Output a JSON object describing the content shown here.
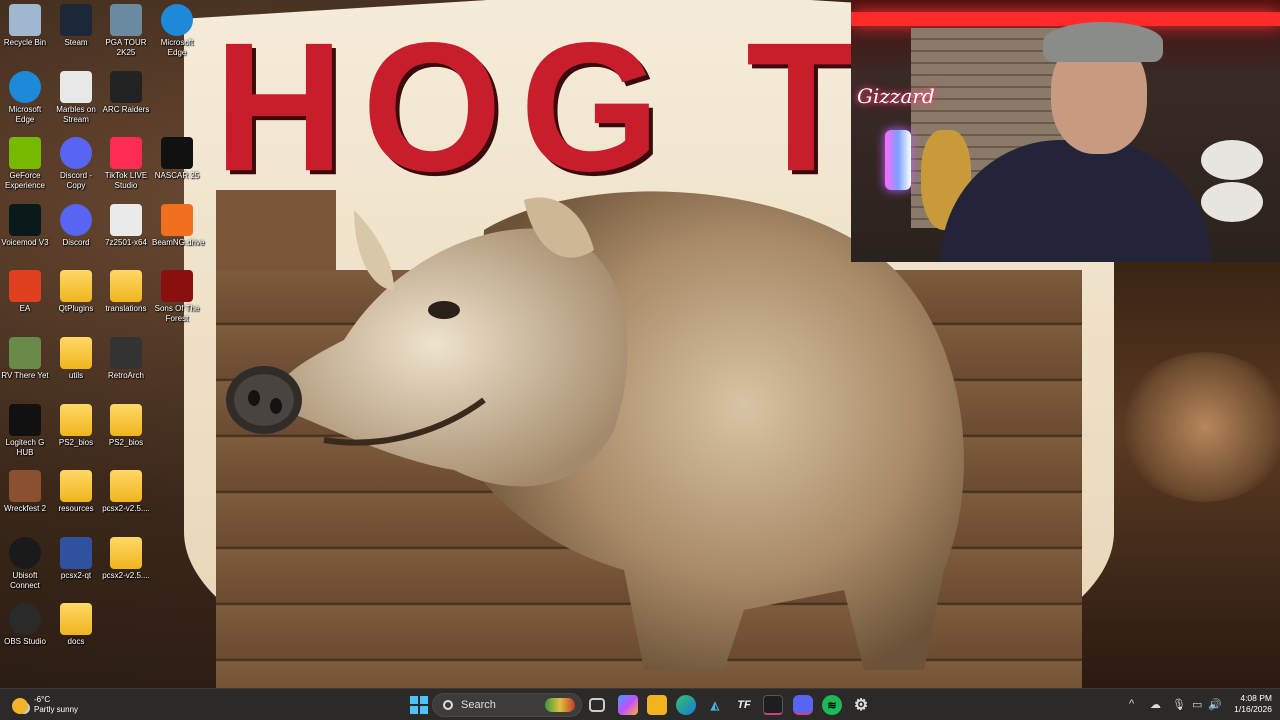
{
  "wallpaper": {
    "title_text": "HOG TAI"
  },
  "desktop_icons": [
    {
      "label": "Recycle Bin",
      "icon": "recycle-bin-icon"
    },
    {
      "label": "Steam",
      "icon": "steam-icon"
    },
    {
      "label": "PGA TOUR 2K25",
      "icon": "pga-tour-icon"
    },
    {
      "label": "Microsoft Edge",
      "icon": "edge-icon"
    },
    {
      "label": "Microsoft Edge",
      "icon": "edge-icon"
    },
    {
      "label": "Marbles on Stream",
      "icon": "marbles-icon"
    },
    {
      "label": "ARC Raiders",
      "icon": "arc-raiders-icon"
    },
    {
      "label": "GeForce Experience",
      "icon": "geforce-icon"
    },
    {
      "label": "Discord - Copy",
      "icon": "discord-icon"
    },
    {
      "label": "TikTok LIVE Studio",
      "icon": "tiktok-icon"
    },
    {
      "label": "NASCAR 25",
      "icon": "nascar-icon"
    },
    {
      "label": "Voicemod V3",
      "icon": "voicemod-icon"
    },
    {
      "label": "Discord",
      "icon": "discord-icon"
    },
    {
      "label": "7z2501-x64",
      "icon": "7zip-icon"
    },
    {
      "label": "BeamNG.drive",
      "icon": "beamng-icon"
    },
    {
      "label": "EA",
      "icon": "ea-icon"
    },
    {
      "label": "QtPlugins",
      "icon": "folder-icon"
    },
    {
      "label": "translations",
      "icon": "folder-icon"
    },
    {
      "label": "Sons Of The Forest",
      "icon": "sons-forest-icon"
    },
    {
      "label": "RV There Yet",
      "icon": "rv-there-yet-icon"
    },
    {
      "label": "utils",
      "icon": "folder-icon"
    },
    {
      "label": "RetroArch",
      "icon": "retroarch-icon"
    },
    {
      "label": "Logitech G HUB",
      "icon": "logitech-icon"
    },
    {
      "label": "PS2_bios",
      "icon": "folder-icon"
    },
    {
      "label": "PS2_bios",
      "icon": "folder-icon"
    },
    {
      "label": "Wreckfest 2",
      "icon": "wreckfest-icon"
    },
    {
      "label": "resources",
      "icon": "folder-icon"
    },
    {
      "label": "pcsx2-v2.5....",
      "icon": "folder-icon"
    },
    {
      "label": "Ubisoft Connect",
      "icon": "ubisoft-icon"
    },
    {
      "label": "pcsx2-qt",
      "icon": "pcsx2-icon"
    },
    {
      "label": "pcsx2-v2.5....",
      "icon": "folder-icon"
    },
    {
      "label": "OBS Studio",
      "icon": "obs-icon"
    },
    {
      "label": "docs",
      "icon": "folder-icon"
    }
  ],
  "webcam": {
    "neon_sign": "Gizzard"
  },
  "taskbar": {
    "weather": {
      "temp": "-6°C",
      "condition": "Partly sunny"
    },
    "search_placeholder": "Search",
    "clock": {
      "time": "4:08 PM",
      "date": "1/16/2026"
    }
  }
}
